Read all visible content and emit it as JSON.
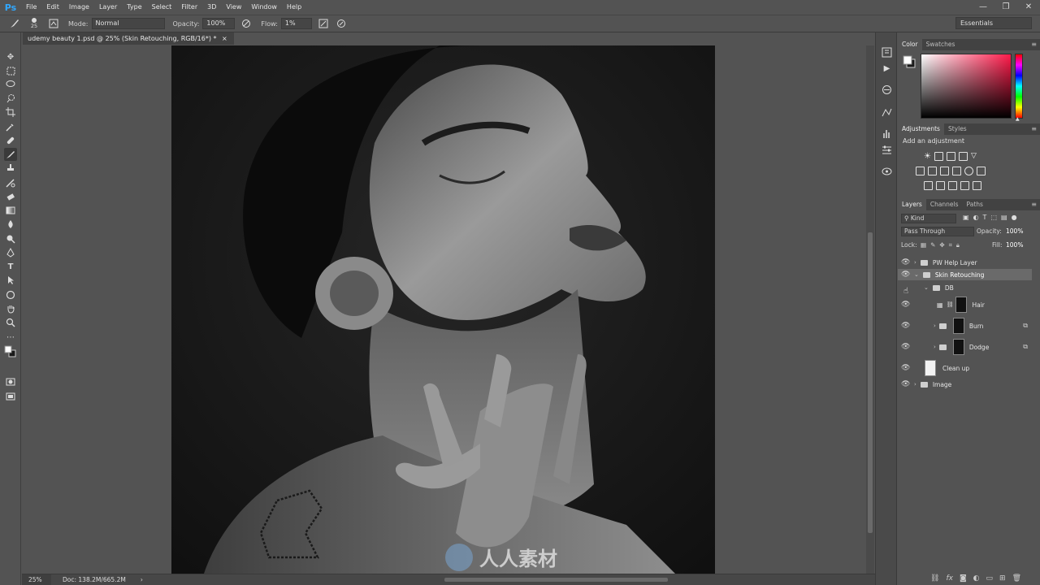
{
  "menubar": {
    "logo": "Ps",
    "items": [
      "File",
      "Edit",
      "Image",
      "Layer",
      "Type",
      "Select",
      "Filter",
      "3D",
      "View",
      "Window",
      "Help"
    ],
    "window_controls": [
      "—",
      "❐",
      "✕"
    ]
  },
  "options": {
    "brush_size": "25",
    "mode_label": "Mode:",
    "mode_value": "Normal",
    "opacity_label": "Opacity:",
    "opacity_value": "100%",
    "flow_label": "Flow:",
    "flow_value": "1%",
    "workspace": "Essentials"
  },
  "document": {
    "tab_title": "udemy beauty 1.psd @ 25% (Skin Retouching, RGB/16*) *",
    "close": "×"
  },
  "status": {
    "zoom": "25%",
    "doc_size": "Doc: 138.2M/665.2M"
  },
  "color_panel": {
    "tabs": [
      "Color",
      "Swatches"
    ]
  },
  "adjustments_panel": {
    "tabs": [
      "Adjustments",
      "Styles"
    ],
    "heading": "Add an adjustment"
  },
  "layers_panel": {
    "tabs": [
      "Layers",
      "Channels",
      "Paths"
    ],
    "filter_kind": "Kind",
    "blend_mode": "Pass Through",
    "opacity_label": "Opacity:",
    "opacity_value": "100%",
    "lock_label": "Lock:",
    "fill_label": "Fill:",
    "fill_value": "100%",
    "layers": [
      {
        "name": "PW Help Layer"
      },
      {
        "name": "Skin Retouching"
      },
      {
        "name": "DB"
      },
      {
        "name": "Hair"
      },
      {
        "name": "Burn"
      },
      {
        "name": "Dodge"
      },
      {
        "name": "Clean up"
      },
      {
        "name": "Image"
      }
    ]
  },
  "watermark": {
    "text": "人人素材"
  },
  "colors": {
    "accent": "#31a8ff",
    "ui_bg": "#535353",
    "panel_dark": "#424242"
  }
}
